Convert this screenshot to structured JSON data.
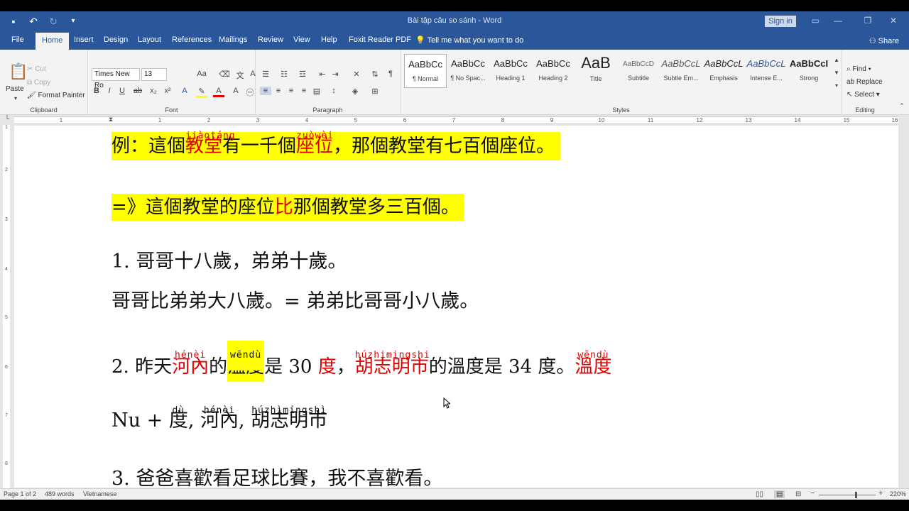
{
  "window": {
    "title": "Bài tập câu so sánh  -  Word",
    "sign_in": "Sign in"
  },
  "tabs": [
    "File",
    "Home",
    "Insert",
    "Design",
    "Layout",
    "References",
    "Mailings",
    "Review",
    "View",
    "Help",
    "Foxit Reader PDF"
  ],
  "tell_me": "Tell me what you want to do",
  "share": "Share",
  "clipboard": {
    "paste": "Paste",
    "cut": "Cut",
    "copy": "Copy",
    "format_painter": "Format Painter",
    "label": "Clipboard"
  },
  "font": {
    "name": "Times New Ro",
    "size": "13",
    "label": "Font"
  },
  "paragraph": {
    "label": "Paragraph"
  },
  "styles": {
    "label": "Styles",
    "items": [
      {
        "preview": "AaBbCc",
        "name": "¶ Normal"
      },
      {
        "preview": "AaBbCc",
        "name": "¶ No Spac..."
      },
      {
        "preview": "AaBbCc",
        "name": "Heading 1"
      },
      {
        "preview": "AaBbCc",
        "name": "Heading 2"
      },
      {
        "preview": "AaB",
        "name": "Title"
      },
      {
        "preview": "AaBbCcD",
        "name": "Subtitle"
      },
      {
        "preview": "AaBbCcL",
        "name": "Subtle Em..."
      },
      {
        "preview": "AaBbCcL",
        "name": "Emphasis"
      },
      {
        "preview": "AaBbCcL",
        "name": "Intense E..."
      },
      {
        "preview": "AaBbCcI",
        "name": "Strong"
      }
    ]
  },
  "editing": {
    "find": "Find",
    "replace": "Replace",
    "select": "Select",
    "label": "Editing"
  },
  "ruler_numbers": [
    "1",
    "1",
    "2",
    "3",
    "4",
    "5",
    "6",
    "7",
    "8",
    "9",
    "10",
    "11",
    "12",
    "13",
    "14",
    "15",
    "16"
  ],
  "vruler_numbers": [
    "1",
    "2",
    "3",
    "4",
    "5",
    "6",
    "7",
    "8"
  ],
  "document": {
    "line1": {
      "a": "例：這個",
      "b": "教堂",
      "b_ruby": "jiàotáng",
      "c": "有一千個",
      "d": "座位",
      "d_ruby": "zuòwèi",
      "e": "，那個教堂有七百個座位。"
    },
    "line2": {
      "a": "=》這個教堂的座位",
      "b": "比",
      "c": "那個教堂多三百個。"
    },
    "line3": "1. 哥哥十八歲，弟弟十歲。",
    "line4": "哥哥比弟弟大八歲。= 弟弟比哥哥小八歲。",
    "line5": {
      "a": "2. 昨天",
      "b": "河內",
      "b_ruby": "hénèi",
      "c": "的",
      "d": "溫度",
      "d_ruby": "wēndù",
      "e": "是 30 ",
      "f": "度",
      "g": "，",
      "h": "胡志明市",
      "h_ruby": "húzhimingshi",
      "i": "的溫度是 34 度。",
      "j": "溫度",
      "j_ruby": "wēndù"
    },
    "line6": {
      "a": "Nu + ",
      "b": "度",
      "b_ruby": "dù",
      "c": ", ",
      "d": "河內",
      "d_ruby": "hénèi",
      "e": ", ",
      "f": "胡志明市",
      "f_ruby": "húzhìmíngshì"
    },
    "line7": "3. 爸爸喜歡看足球比賽，我不喜歡看。"
  },
  "status": {
    "page": "Page 1 of 2",
    "words": "489 words",
    "language": "Vietnamese",
    "zoom": "220%"
  },
  "colors": {
    "word_blue": "#2b579a",
    "highlight": "#ffff00",
    "red_text": "#e00000"
  }
}
